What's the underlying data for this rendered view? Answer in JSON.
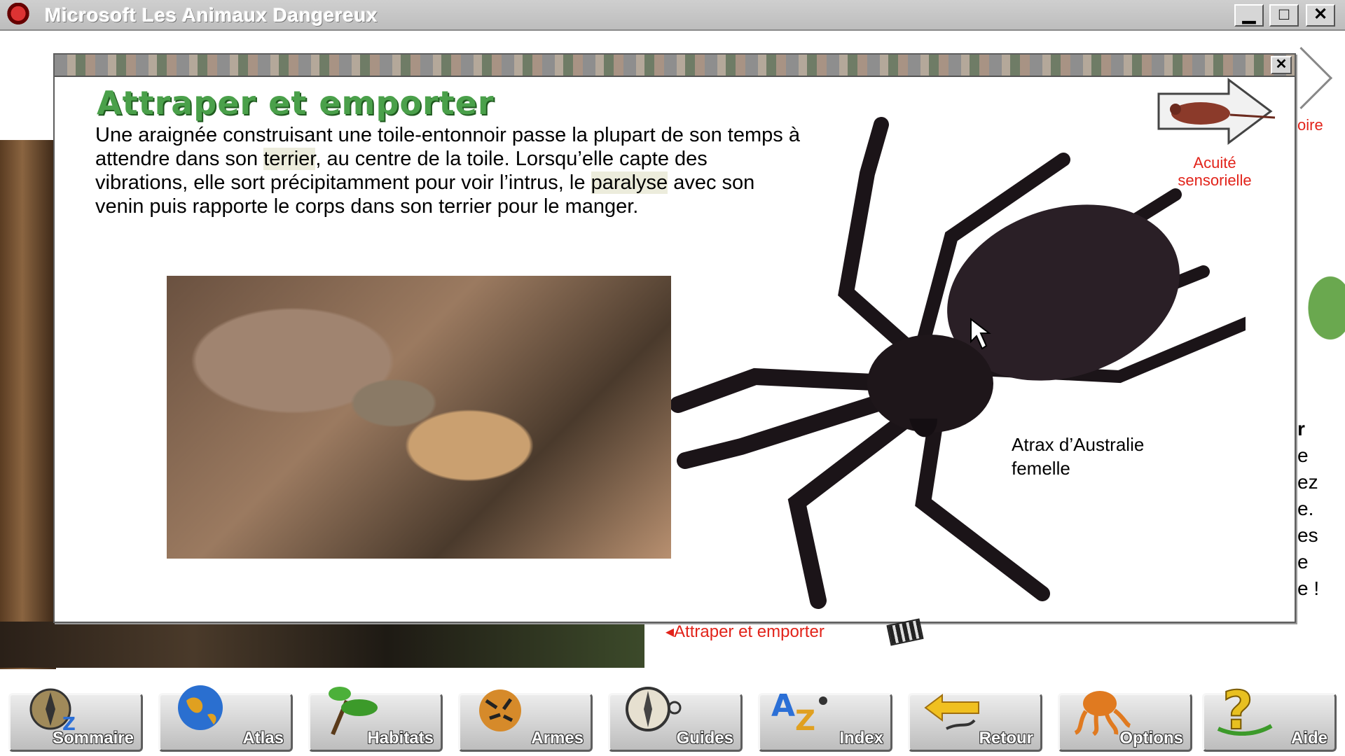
{
  "window": {
    "title": "Microsoft Les Animaux Dangereux",
    "min_label": "▁",
    "max_label": "□",
    "close_label": "✕"
  },
  "background": {
    "right_link": "oire",
    "right_text_fragments": [
      "r",
      "e",
      "ez",
      "e.",
      "es",
      "e",
      "e !"
    ]
  },
  "popup": {
    "close_label": "✕",
    "heading": "Attraper et emporter",
    "text": {
      "p1": "Une araignée construisant une toile-entonnoir passe la plupart de son temps à attendre dans son ",
      "term1": "terrier",
      "p2": ", au centre de la toile. Lorsqu’elle capte des vibrations, elle sort précipitamment pour voir l’intrus, le ",
      "term2": "paralyse",
      "p3": " avec son venin puis rapporte le corps dans son terrier pour le manger."
    },
    "caption_line1": "Atrax d’Australie",
    "caption_line2": "femelle",
    "sense_link_line1": "Acuité",
    "sense_link_line2": "sensorielle"
  },
  "video_label": "◂Attraper et emporter",
  "toolbar": [
    {
      "label": "Sommaire",
      "icon": "compass-az-icon"
    },
    {
      "label": "Atlas",
      "icon": "globe-icon"
    },
    {
      "label": "Habitats",
      "icon": "plant-icon"
    },
    {
      "label": "Armes",
      "icon": "tiger-icon"
    },
    {
      "label": "Guides",
      "icon": "compass-icon"
    },
    {
      "label": "Index",
      "icon": "az-spider-icon"
    },
    {
      "label": "Retour",
      "icon": "back-arrow-scorpion-icon"
    },
    {
      "label": "Options",
      "icon": "octopus-icon"
    },
    {
      "label": "Aide",
      "icon": "snake-question-icon"
    }
  ],
  "colors": {
    "heading_green": "#4aa04a",
    "link_red": "#e2231a",
    "highlight": "#ececdc"
  }
}
